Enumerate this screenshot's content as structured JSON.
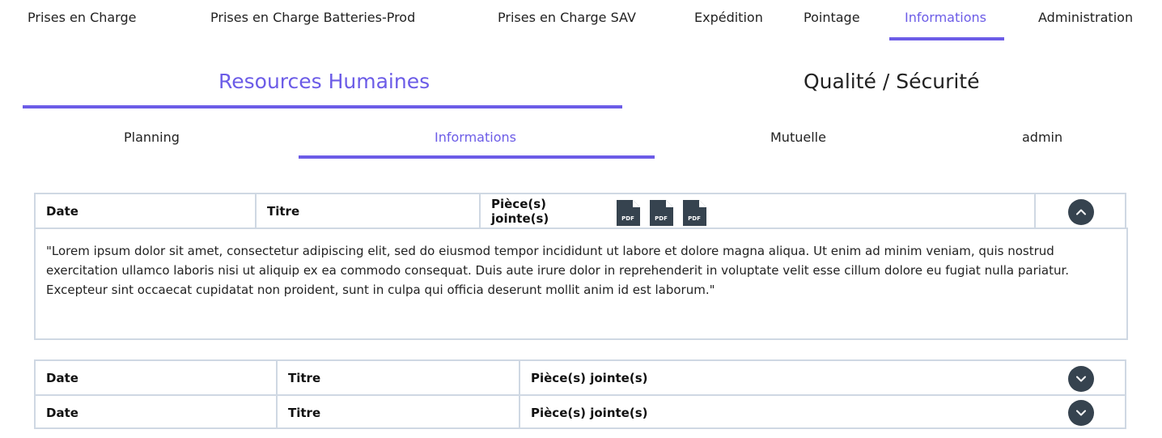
{
  "top_nav": {
    "items": [
      {
        "label": "Prises en Charge"
      },
      {
        "label": "Prises en Charge Batteries-Prod"
      },
      {
        "label": "Prises en Charge SAV"
      },
      {
        "label": "Expédition"
      },
      {
        "label": "Pointage"
      },
      {
        "label": "Informations",
        "active": true
      },
      {
        "label": "Administration"
      }
    ]
  },
  "section_tabs": [
    {
      "label": "Resources Humaines",
      "active": true
    },
    {
      "label": "Qualité / Sécurité"
    }
  ],
  "sub_tabs": [
    {
      "label": "Planning"
    },
    {
      "label": "Informations",
      "active": true
    },
    {
      "label": "Mutuelle"
    },
    {
      "label": "admin"
    }
  ],
  "table": {
    "headers": {
      "date": "Date",
      "title": "Titre",
      "attachments": "Pièce(s) jointe(s)"
    },
    "expanded_row": {
      "date": "Date",
      "title": "Titre",
      "attachments": "Pièce(s) jointe(s)",
      "pdf_icons": [
        "pdf-icon",
        "pdf-icon",
        "pdf-icon"
      ],
      "toggle_icon": "chevron-up-icon",
      "content": "\"Lorem ipsum dolor sit amet, consectetur adipiscing elit, sed do eiusmod tempor incididunt ut labore et dolore magna aliqua. Ut enim ad minim veniam, quis nostrud exercitation ullamco laboris nisi ut aliquip ex ea commodo consequat. Duis aute irure dolor in reprehenderit in voluptate velit esse cillum dolore eu fugiat nulla pariatur. Excepteur sint occaecat cupidatat non proident, sunt in culpa qui officia deserunt mollit anim id est laborum.\""
    },
    "collapsed_rows": [
      {
        "date": "Date",
        "title": "Titre",
        "attachments": "Pièce(s) jointe(s)",
        "toggle_icon": "chevron-down-icon"
      },
      {
        "date": "Date",
        "title": "Titre",
        "attachments": "Pièce(s) jointe(s)",
        "toggle_icon": "chevron-down-icon"
      }
    ]
  },
  "colors": {
    "accent": "#6c5ce7",
    "border": "#cfd8e3",
    "toggle_bg": "#36434f"
  }
}
